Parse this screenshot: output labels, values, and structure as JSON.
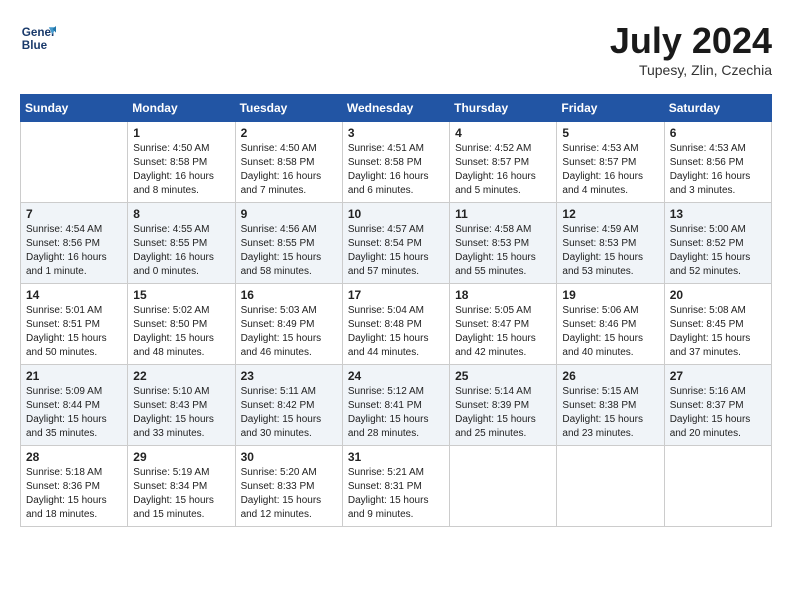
{
  "header": {
    "logo_line1": "General",
    "logo_line2": "Blue",
    "month_title": "July 2024",
    "location": "Tupesy, Zlin, Czechia"
  },
  "weekdays": [
    "Sunday",
    "Monday",
    "Tuesday",
    "Wednesday",
    "Thursday",
    "Friday",
    "Saturday"
  ],
  "weeks": [
    [
      {
        "day": "",
        "sunrise": "",
        "sunset": "",
        "daylight": ""
      },
      {
        "day": "1",
        "sunrise": "Sunrise: 4:50 AM",
        "sunset": "Sunset: 8:58 PM",
        "daylight": "Daylight: 16 hours and 8 minutes."
      },
      {
        "day": "2",
        "sunrise": "Sunrise: 4:50 AM",
        "sunset": "Sunset: 8:58 PM",
        "daylight": "Daylight: 16 hours and 7 minutes."
      },
      {
        "day": "3",
        "sunrise": "Sunrise: 4:51 AM",
        "sunset": "Sunset: 8:58 PM",
        "daylight": "Daylight: 16 hours and 6 minutes."
      },
      {
        "day": "4",
        "sunrise": "Sunrise: 4:52 AM",
        "sunset": "Sunset: 8:57 PM",
        "daylight": "Daylight: 16 hours and 5 minutes."
      },
      {
        "day": "5",
        "sunrise": "Sunrise: 4:53 AM",
        "sunset": "Sunset: 8:57 PM",
        "daylight": "Daylight: 16 hours and 4 minutes."
      },
      {
        "day": "6",
        "sunrise": "Sunrise: 4:53 AM",
        "sunset": "Sunset: 8:56 PM",
        "daylight": "Daylight: 16 hours and 3 minutes."
      }
    ],
    [
      {
        "day": "7",
        "sunrise": "Sunrise: 4:54 AM",
        "sunset": "Sunset: 8:56 PM",
        "daylight": "Daylight: 16 hours and 1 minute."
      },
      {
        "day": "8",
        "sunrise": "Sunrise: 4:55 AM",
        "sunset": "Sunset: 8:55 PM",
        "daylight": "Daylight: 16 hours and 0 minutes."
      },
      {
        "day": "9",
        "sunrise": "Sunrise: 4:56 AM",
        "sunset": "Sunset: 8:55 PM",
        "daylight": "Daylight: 15 hours and 58 minutes."
      },
      {
        "day": "10",
        "sunrise": "Sunrise: 4:57 AM",
        "sunset": "Sunset: 8:54 PM",
        "daylight": "Daylight: 15 hours and 57 minutes."
      },
      {
        "day": "11",
        "sunrise": "Sunrise: 4:58 AM",
        "sunset": "Sunset: 8:53 PM",
        "daylight": "Daylight: 15 hours and 55 minutes."
      },
      {
        "day": "12",
        "sunrise": "Sunrise: 4:59 AM",
        "sunset": "Sunset: 8:53 PM",
        "daylight": "Daylight: 15 hours and 53 minutes."
      },
      {
        "day": "13",
        "sunrise": "Sunrise: 5:00 AM",
        "sunset": "Sunset: 8:52 PM",
        "daylight": "Daylight: 15 hours and 52 minutes."
      }
    ],
    [
      {
        "day": "14",
        "sunrise": "Sunrise: 5:01 AM",
        "sunset": "Sunset: 8:51 PM",
        "daylight": "Daylight: 15 hours and 50 minutes."
      },
      {
        "day": "15",
        "sunrise": "Sunrise: 5:02 AM",
        "sunset": "Sunset: 8:50 PM",
        "daylight": "Daylight: 15 hours and 48 minutes."
      },
      {
        "day": "16",
        "sunrise": "Sunrise: 5:03 AM",
        "sunset": "Sunset: 8:49 PM",
        "daylight": "Daylight: 15 hours and 46 minutes."
      },
      {
        "day": "17",
        "sunrise": "Sunrise: 5:04 AM",
        "sunset": "Sunset: 8:48 PM",
        "daylight": "Daylight: 15 hours and 44 minutes."
      },
      {
        "day": "18",
        "sunrise": "Sunrise: 5:05 AM",
        "sunset": "Sunset: 8:47 PM",
        "daylight": "Daylight: 15 hours and 42 minutes."
      },
      {
        "day": "19",
        "sunrise": "Sunrise: 5:06 AM",
        "sunset": "Sunset: 8:46 PM",
        "daylight": "Daylight: 15 hours and 40 minutes."
      },
      {
        "day": "20",
        "sunrise": "Sunrise: 5:08 AM",
        "sunset": "Sunset: 8:45 PM",
        "daylight": "Daylight: 15 hours and 37 minutes."
      }
    ],
    [
      {
        "day": "21",
        "sunrise": "Sunrise: 5:09 AM",
        "sunset": "Sunset: 8:44 PM",
        "daylight": "Daylight: 15 hours and 35 minutes."
      },
      {
        "day": "22",
        "sunrise": "Sunrise: 5:10 AM",
        "sunset": "Sunset: 8:43 PM",
        "daylight": "Daylight: 15 hours and 33 minutes."
      },
      {
        "day": "23",
        "sunrise": "Sunrise: 5:11 AM",
        "sunset": "Sunset: 8:42 PM",
        "daylight": "Daylight: 15 hours and 30 minutes."
      },
      {
        "day": "24",
        "sunrise": "Sunrise: 5:12 AM",
        "sunset": "Sunset: 8:41 PM",
        "daylight": "Daylight: 15 hours and 28 minutes."
      },
      {
        "day": "25",
        "sunrise": "Sunrise: 5:14 AM",
        "sunset": "Sunset: 8:39 PM",
        "daylight": "Daylight: 15 hours and 25 minutes."
      },
      {
        "day": "26",
        "sunrise": "Sunrise: 5:15 AM",
        "sunset": "Sunset: 8:38 PM",
        "daylight": "Daylight: 15 hours and 23 minutes."
      },
      {
        "day": "27",
        "sunrise": "Sunrise: 5:16 AM",
        "sunset": "Sunset: 8:37 PM",
        "daylight": "Daylight: 15 hours and 20 minutes."
      }
    ],
    [
      {
        "day": "28",
        "sunrise": "Sunrise: 5:18 AM",
        "sunset": "Sunset: 8:36 PM",
        "daylight": "Daylight: 15 hours and 18 minutes."
      },
      {
        "day": "29",
        "sunrise": "Sunrise: 5:19 AM",
        "sunset": "Sunset: 8:34 PM",
        "daylight": "Daylight: 15 hours and 15 minutes."
      },
      {
        "day": "30",
        "sunrise": "Sunrise: 5:20 AM",
        "sunset": "Sunset: 8:33 PM",
        "daylight": "Daylight: 15 hours and 12 minutes."
      },
      {
        "day": "31",
        "sunrise": "Sunrise: 5:21 AM",
        "sunset": "Sunset: 8:31 PM",
        "daylight": "Daylight: 15 hours and 9 minutes."
      },
      {
        "day": "",
        "sunrise": "",
        "sunset": "",
        "daylight": ""
      },
      {
        "day": "",
        "sunrise": "",
        "sunset": "",
        "daylight": ""
      },
      {
        "day": "",
        "sunrise": "",
        "sunset": "",
        "daylight": ""
      }
    ]
  ]
}
